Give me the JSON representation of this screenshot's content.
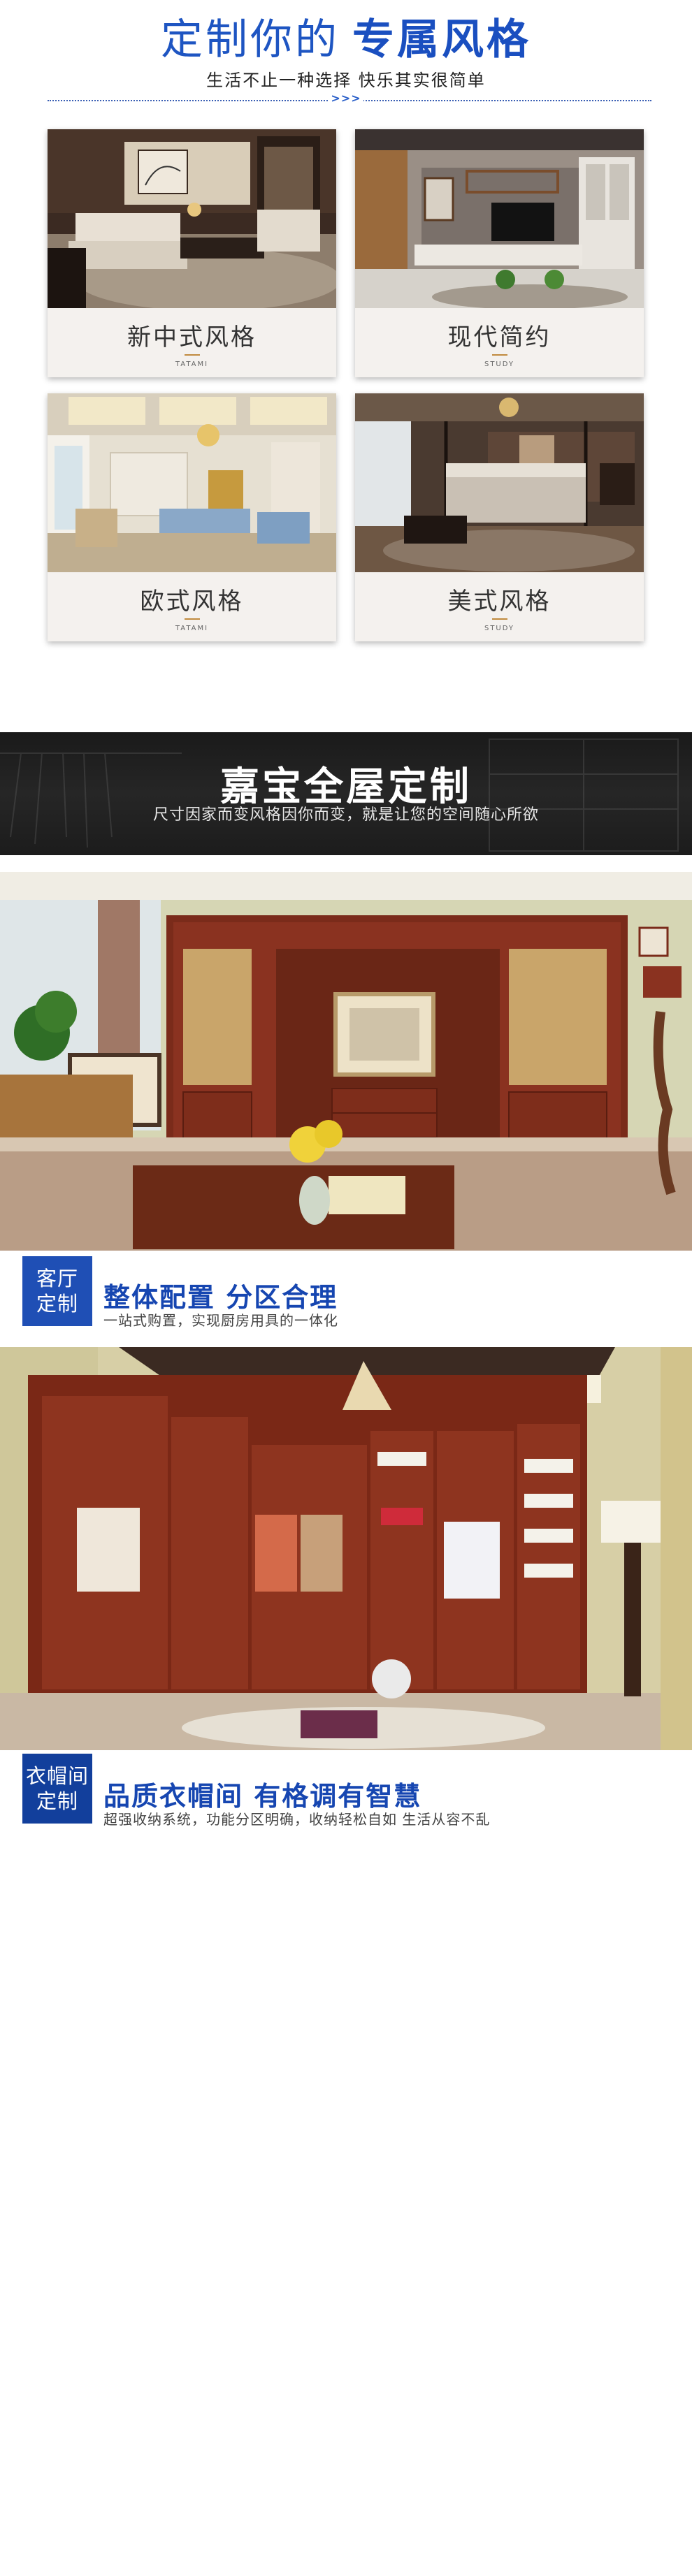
{
  "header": {
    "title_part1": "定制你的",
    "title_part2": "专属风格",
    "subtitle": "生活不止一种选择  快乐其实很简单",
    "arrows": ">>>"
  },
  "styles": [
    {
      "name": "新中式风格",
      "en": "TATAMI"
    },
    {
      "name": "现代简约",
      "en": "STUDY"
    },
    {
      "name": "欧式风格",
      "en": "TATAMI"
    },
    {
      "name": "美式风格",
      "en": "STUDY"
    }
  ],
  "banner": {
    "title": "嘉宝全屋定制",
    "subtitle": "尺寸因家而变风格因你而变，就是让您的空间随心所欲"
  },
  "sections": [
    {
      "tag_line1": "客厅",
      "tag_line2": "定制",
      "heading": "整体配置 分区合理",
      "subheading": "一站式购置，实现厨房用具的一体化"
    },
    {
      "tag_line1": "衣帽间",
      "tag_line2": "定制",
      "heading": "品质衣帽间 有格调有智慧",
      "subheading": "超强收纳系统，功能分区明确，收纳轻松自如  生活从容不乱"
    }
  ],
  "colors": {
    "brand_blue": "#1f4fb5",
    "heading_blue": "#1646b1",
    "accent_gold": "#c08a3e"
  }
}
